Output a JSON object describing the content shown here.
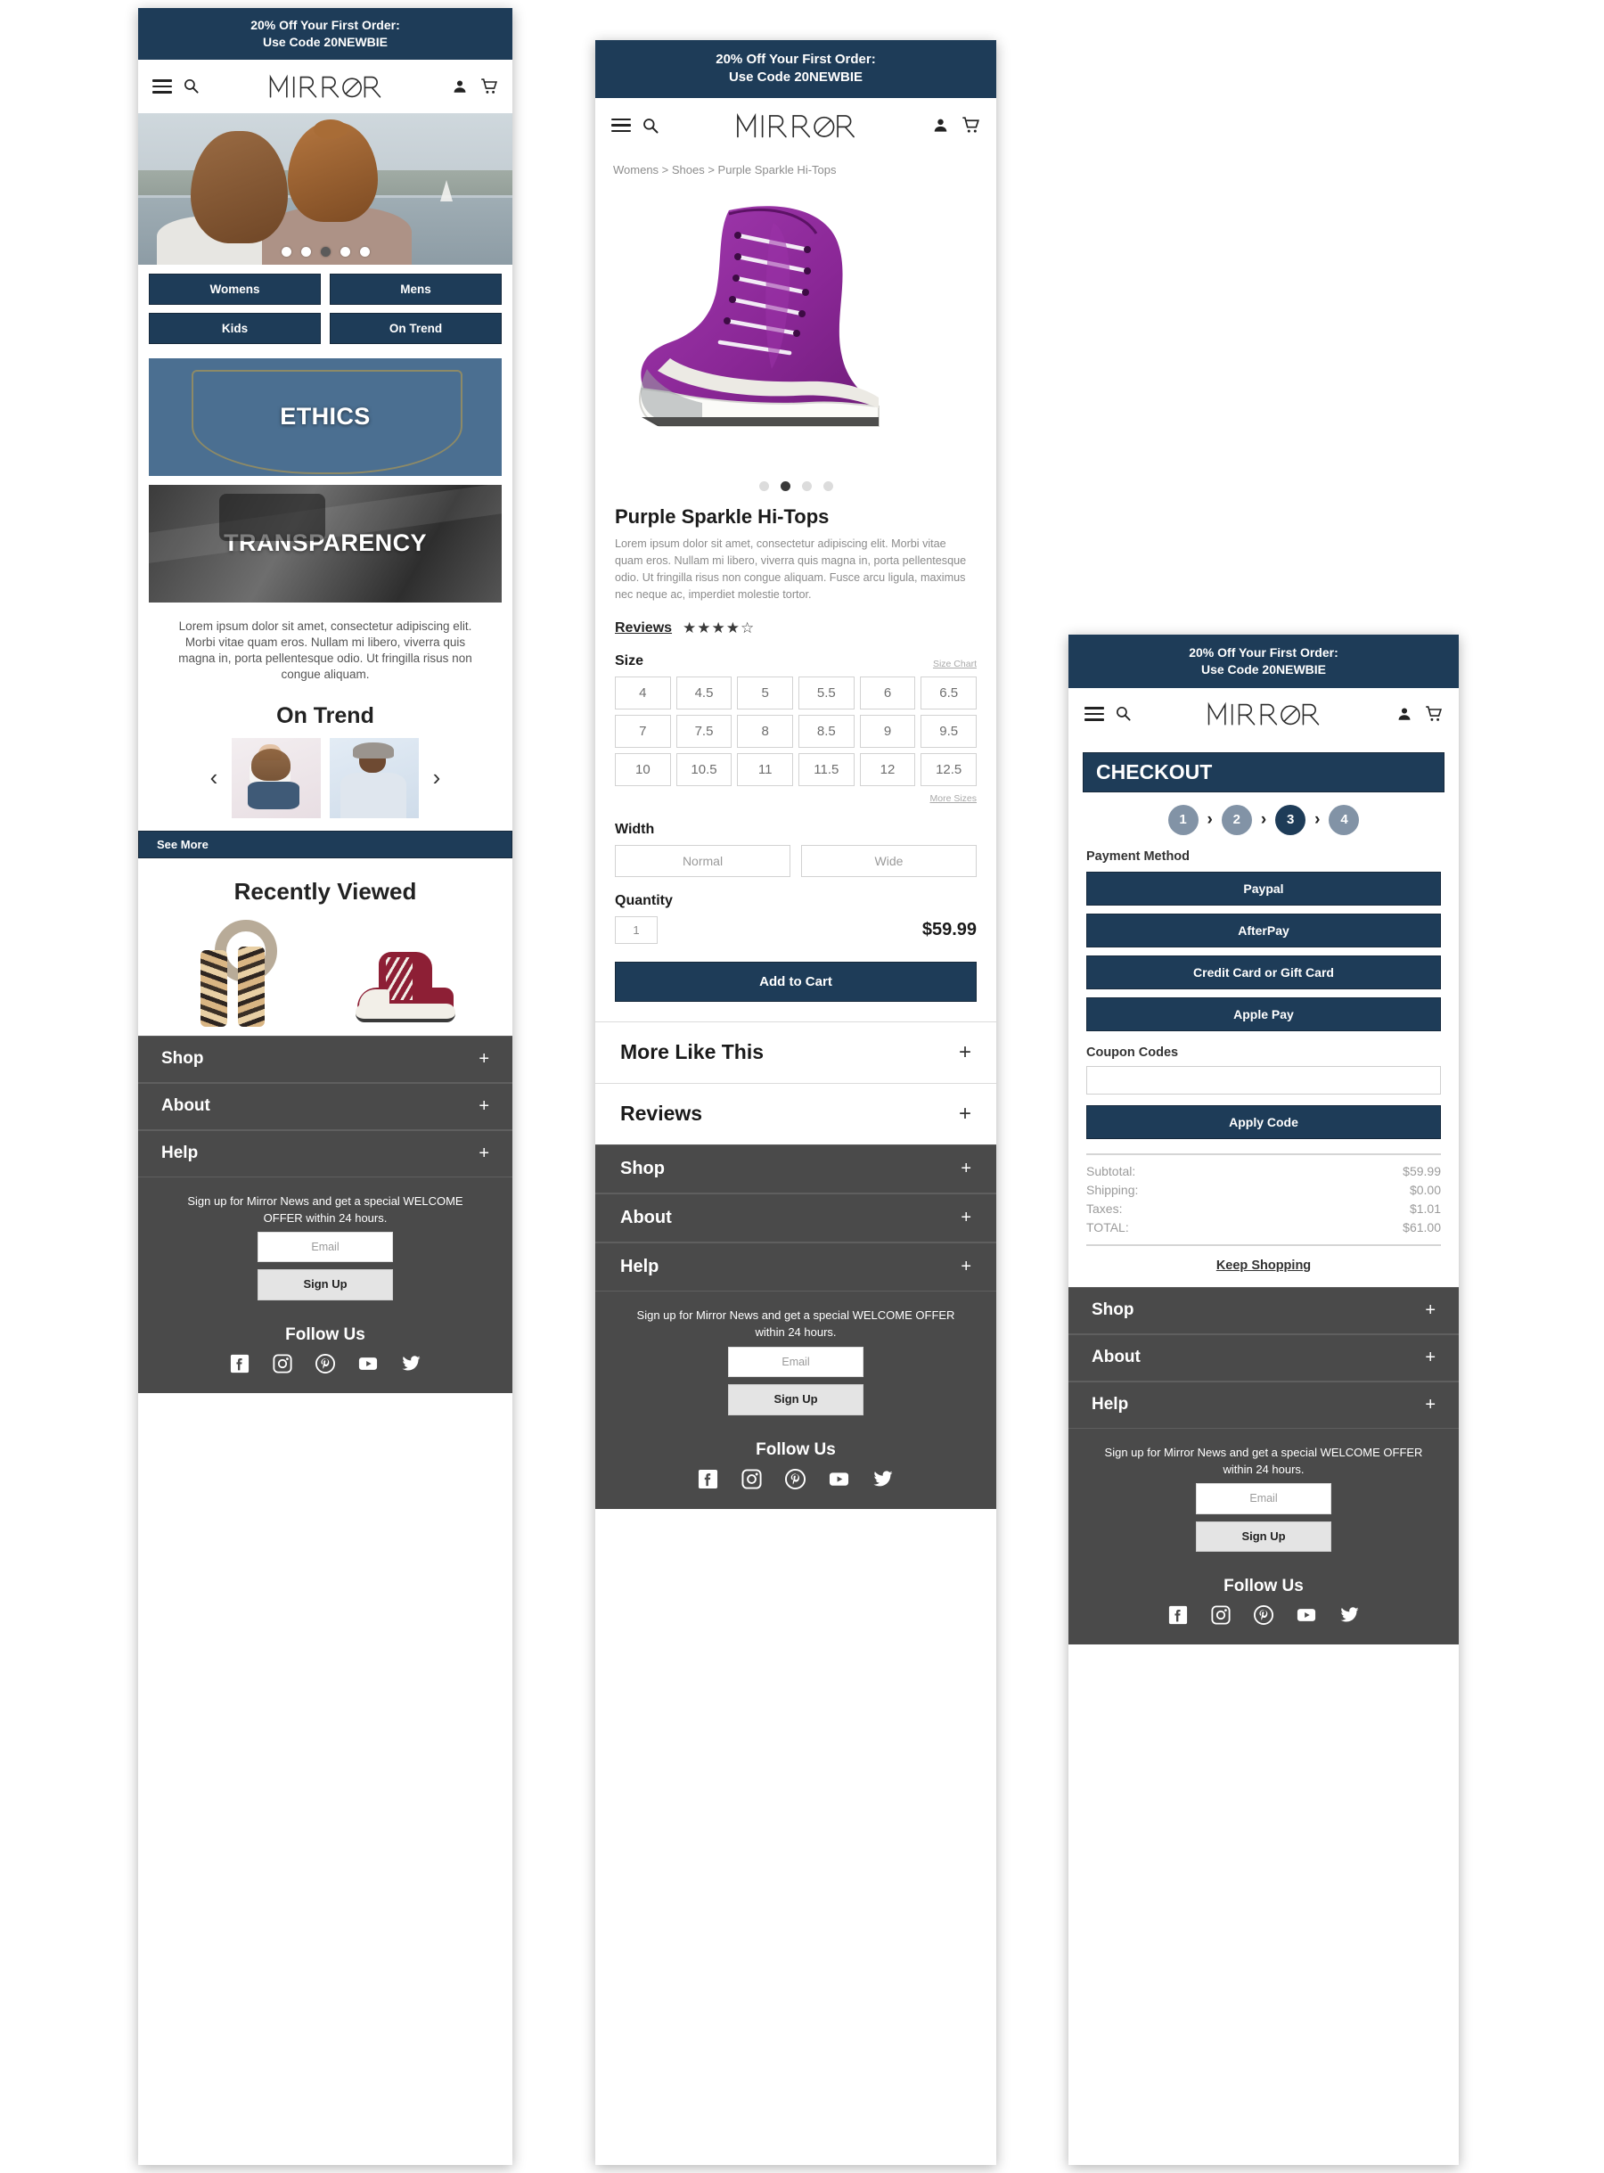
{
  "brand": {
    "name": "MIRROR"
  },
  "promo": {
    "line1": "20% Off Your First Order:",
    "line2": "Use Code 20NEWBIE"
  },
  "icons": {
    "menu": "hamburger-menu-icon",
    "search": "search-icon",
    "account": "user-account-icon",
    "cart": "shopping-cart-icon"
  },
  "home": {
    "hero": {
      "dots": 5,
      "active_index": 2
    },
    "categories": [
      "Womens",
      "Mens",
      "Kids",
      "On Trend"
    ],
    "tiles": [
      {
        "label": "ETHICS",
        "image": "denim-jeans-pocket"
      },
      {
        "label": "TRANSPARENCY",
        "image": "sewing-machine-factory"
      }
    ],
    "about_copy": "Lorem ipsum dolor sit amet, consectetur adipiscing elit. Morbi vitae quam eros. Nullam mi libero, viverra quis magna in, porta pellentesque odio. Ut fringilla risus non congue aliquam.",
    "on_trend": {
      "title": "On Trend",
      "prev": "‹",
      "next": "›",
      "see_more": "See More"
    },
    "recently_viewed": {
      "title": "Recently Viewed",
      "items": [
        "leopard-print-scarf",
        "burgundy-hi-top-sneaker"
      ]
    }
  },
  "product": {
    "breadcrumb": "Womens > Shoes > Purple Sparkle Hi-Tops",
    "gallery": {
      "dots": 4,
      "active_index": 1,
      "image": "purple-high-top-sneaker"
    },
    "title": "Purple Sparkle Hi-Tops",
    "description": "Lorem ipsum dolor sit amet, consectetur adipiscing elit. Morbi vitae quam eros. Nullam mi libero, viverra quis magna in, porta pellentesque odio. Ut fringilla risus non congue aliquam. Fusce arcu ligula, maximus nec neque ac, imperdiet molestie tortor.",
    "reviews_link": "Reviews",
    "rating": {
      "value": 4,
      "max": 5,
      "filled": "★★★★",
      "empty": "☆"
    },
    "size_label": "Size",
    "size_chart_link": "Size Chart",
    "sizes": [
      "4",
      "4.5",
      "5",
      "5.5",
      "6",
      "6.5",
      "7",
      "7.5",
      "8",
      "8.5",
      "9",
      "9.5",
      "10",
      "10.5",
      "11",
      "11.5",
      "12",
      "12.5"
    ],
    "more_sizes_link": "More Sizes",
    "width_label": "Width",
    "widths": [
      "Normal",
      "Wide"
    ],
    "quantity_label": "Quantity",
    "quantity_value": "1",
    "price": "$59.99",
    "add_to_cart": "Add to Cart",
    "accordions": [
      {
        "label": "More Like This",
        "toggle": "+"
      },
      {
        "label": "Reviews",
        "toggle": "+"
      }
    ]
  },
  "checkout": {
    "title": "CHECKOUT",
    "steps": [
      "1",
      "2",
      "3",
      "4"
    ],
    "active_step": 3,
    "chevron": "›",
    "payment_label": "Payment Method",
    "payment_methods": [
      "Paypal",
      "AfterPay",
      "Credit Card or Gift Card",
      "Apple Pay"
    ],
    "coupon_label": "Coupon Codes",
    "coupon_value": "",
    "coupon_placeholder": "",
    "apply_label": "Apply Code",
    "summary": [
      {
        "label": "Subtotal:",
        "value": "$59.99"
      },
      {
        "label": "Shipping:",
        "value": "$0.00"
      },
      {
        "label": "Taxes:",
        "value": "$1.01"
      },
      {
        "label": "TOTAL:",
        "value": "$61.00"
      }
    ],
    "keep_shopping": "Keep Shopping"
  },
  "footer": {
    "accordions": [
      {
        "label": "Shop",
        "toggle": "+"
      },
      {
        "label": "About",
        "toggle": "+"
      },
      {
        "label": "Help",
        "toggle": "+"
      }
    ],
    "signup_text": "Sign up for Mirror News and get a special WELCOME OFFER within 24 hours.",
    "email_placeholder": "Email",
    "email_value": "Email",
    "signup_button": "Sign Up",
    "follow_label": "Follow Us",
    "social": [
      "facebook-icon",
      "instagram-icon",
      "pinterest-icon",
      "youtube-icon",
      "twitter-icon"
    ]
  },
  "colors": {
    "navy": "#1e3c58",
    "footer_gray": "#4a4a4a",
    "step_inactive": "#8293a6"
  }
}
